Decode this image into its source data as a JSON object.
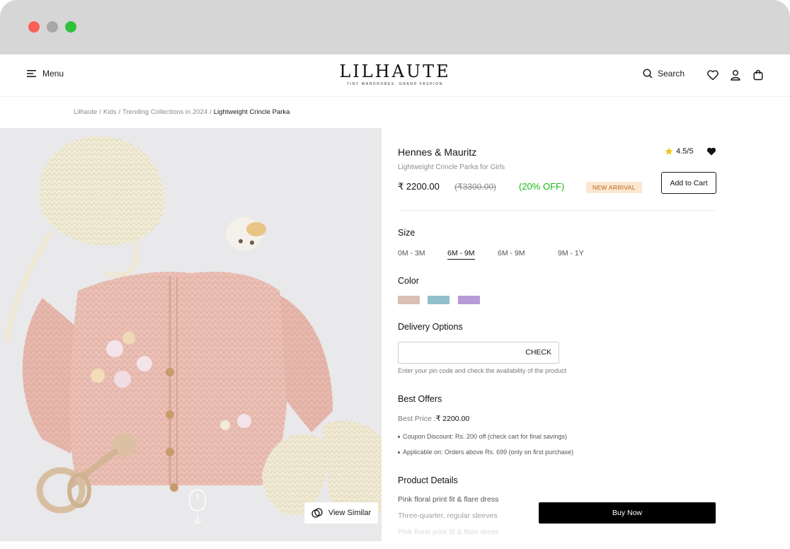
{
  "header": {
    "menu_label": "Menu",
    "logo_word": "LILHAUTE",
    "logo_tagline": "TINY WARDROBES. GRAND FASHION",
    "search_label": "Search"
  },
  "breadcrumb": {
    "items": [
      "Lilhaute",
      "Kids",
      "Trending Collections in 2024"
    ],
    "current": "Lightweight Crincle Parka",
    "separator": "/"
  },
  "gallery": {
    "view_similar_label": "View Similar"
  },
  "product": {
    "brand": "Hennes & Mauritz",
    "subtitle": "Lightweight Crincle Parka for Girls",
    "rating": "4.5/5",
    "price": "₹ 2200.00",
    "mrp": "(₹3300.00)",
    "discount": "(20% OFF)",
    "badge": "NEW ARRIVAL",
    "add_to_cart_label": "Add to Cart"
  },
  "size": {
    "title": "Size",
    "options": [
      "0M - 3M",
      "6M - 9M",
      "6M - 9M",
      "9M - 1Y"
    ],
    "selected_index": 1
  },
  "color": {
    "title": "Color",
    "swatches": [
      "#d9c0b3",
      "#8fc0cb",
      "#b79ad8"
    ]
  },
  "delivery": {
    "title": "Delivery Options",
    "input_value": "",
    "input_placeholder": "",
    "check_label": "CHECK",
    "hint": "Enter your pin code and check the availability of the product"
  },
  "offers": {
    "title": "Best Offers",
    "best_price_label": "Best Price :",
    "best_price_value": "₹ 2200.00",
    "items": [
      "Coupon Discount: Rs. 200 off (check cart for final savings)",
      "Applicable on: Orders above Rs. 699 (only on first purchase)"
    ]
  },
  "details": {
    "title": "Product Details",
    "lines": [
      "Pink floral print fit & flare dress",
      "Three-quarter, regular sleeves",
      "Pink floral print fit & flare dress"
    ],
    "buy_now_label": "Buy Now"
  },
  "colors": {
    "accent_green": "#1cb81c",
    "badge_bg": "#fbe7cf",
    "badge_text": "#b5671d",
    "star": "#f5c518"
  }
}
